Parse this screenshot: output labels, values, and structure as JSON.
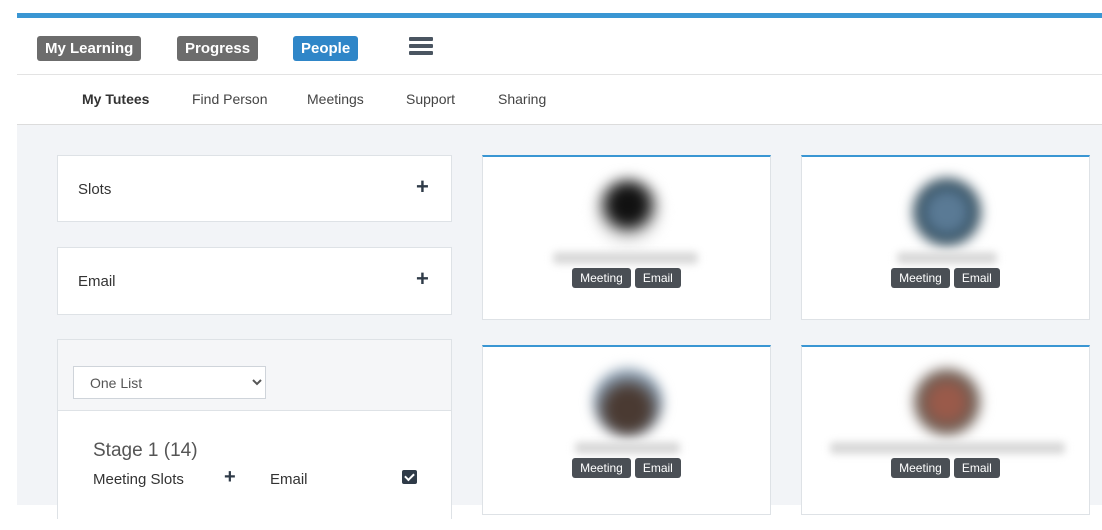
{
  "nav": {
    "tabs": [
      {
        "label": "My Learning",
        "active": false
      },
      {
        "label": "Progress",
        "active": false
      },
      {
        "label": "People",
        "active": true
      }
    ],
    "menu_icon": "hamburger-icon"
  },
  "subnav": {
    "items": [
      {
        "label": "My Tutees",
        "active": true
      },
      {
        "label": "Find Person",
        "active": false
      },
      {
        "label": "Meetings",
        "active": false
      },
      {
        "label": "Support",
        "active": false
      },
      {
        "label": "Sharing",
        "active": false
      }
    ]
  },
  "sidebar": {
    "slots_title": "Slots",
    "email_title": "Email",
    "list_select": {
      "value": "One List",
      "options": [
        "One List"
      ]
    },
    "stage": {
      "title": "Stage 1 (14)",
      "meeting_slots_label": "Meeting Slots",
      "email_label": "Email"
    }
  },
  "cards": [
    {
      "meeting_label": "Meeting",
      "email_label": "Email"
    },
    {
      "meeting_label": "Meeting",
      "email_label": "Email"
    },
    {
      "meeting_label": "Meeting",
      "email_label": "Email"
    },
    {
      "meeting_label": "Meeting",
      "email_label": "Email"
    }
  ],
  "colors": {
    "accent": "#3a96d3",
    "active_tab": "#2f86c8",
    "inactive_tab": "#6c6c6c"
  }
}
